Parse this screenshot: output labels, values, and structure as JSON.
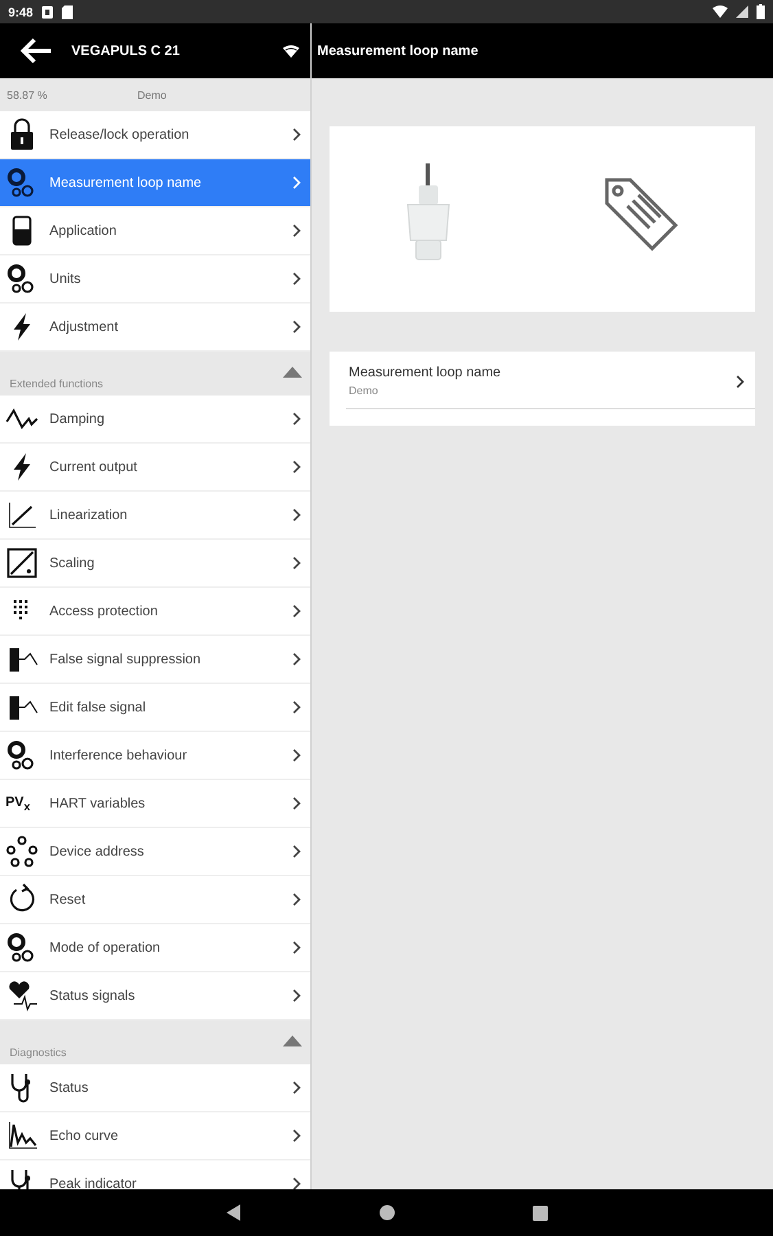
{
  "status_bar": {
    "time": "9:48"
  },
  "app_bar": {
    "device_title": "VEGAPULS C 21",
    "page_title": "Measurement loop name"
  },
  "sidebar": {
    "reading": "58.87 %",
    "tag": "Demo",
    "sections": [
      {
        "items": [
          {
            "label": "Release/lock operation",
            "selected": false
          },
          {
            "label": "Measurement loop name",
            "selected": true
          },
          {
            "label": "Application",
            "selected": false
          },
          {
            "label": "Units",
            "selected": false
          },
          {
            "label": "Adjustment",
            "selected": false
          }
        ]
      },
      {
        "title": "Extended functions",
        "expanded": true,
        "items": [
          {
            "label": "Damping",
            "selected": false
          },
          {
            "label": "Current output",
            "selected": false
          },
          {
            "label": "Linearization",
            "selected": false
          },
          {
            "label": "Scaling",
            "selected": false
          },
          {
            "label": "Access protection",
            "selected": false
          },
          {
            "label": "False signal suppression",
            "selected": false
          },
          {
            "label": "Edit false signal",
            "selected": false
          },
          {
            "label": "Interference behaviour",
            "selected": false
          },
          {
            "label": "HART variables",
            "selected": false,
            "icon_text": "PV$_{x}$"
          },
          {
            "label": "Device address",
            "selected": false
          },
          {
            "label": "Reset",
            "selected": false
          },
          {
            "label": "Mode of operation",
            "selected": false
          },
          {
            "label": "Status signals",
            "selected": false
          }
        ]
      },
      {
        "title": "Diagnostics",
        "expanded": true,
        "items": [
          {
            "label": "Status",
            "selected": false
          },
          {
            "label": "Echo curve",
            "selected": false
          },
          {
            "label": "Peak indicator",
            "selected": false
          }
        ]
      }
    ]
  },
  "detail": {
    "setting": {
      "label": "Measurement loop name",
      "value": "Demo"
    }
  }
}
